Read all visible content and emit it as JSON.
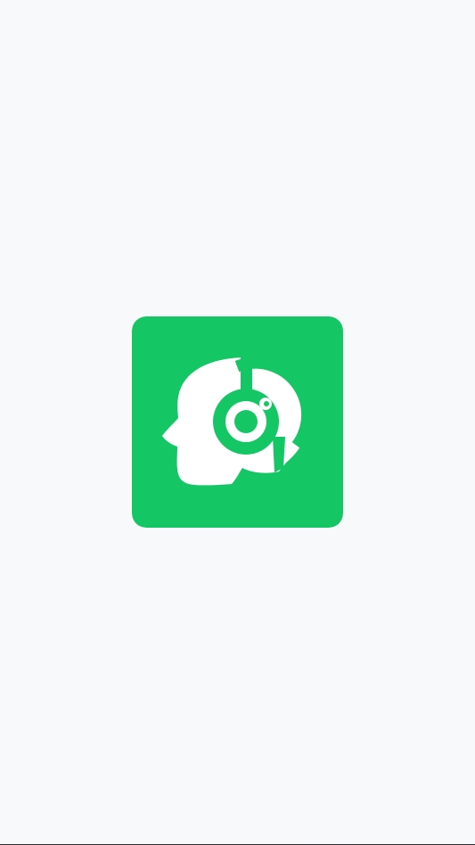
{
  "splash": {
    "logo": {
      "icon": "head-headset-logo-icon",
      "background_color": "#14c764",
      "foreground_color": "#ffffff"
    },
    "screen_background_color": "#f8f9fa"
  }
}
